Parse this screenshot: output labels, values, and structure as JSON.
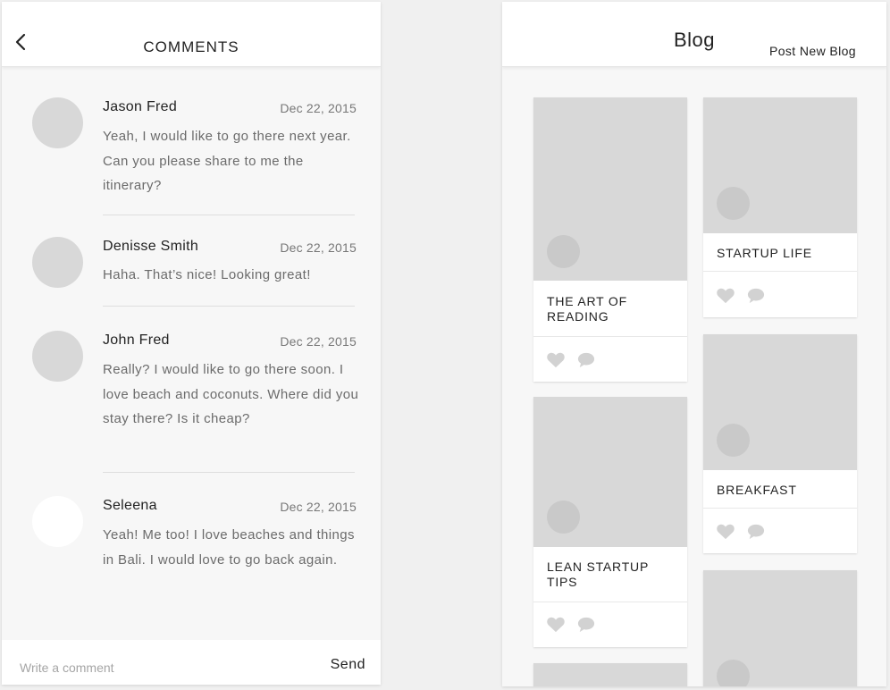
{
  "comments_screen": {
    "title": "COMMENTS",
    "back_icon": "chevron-left-icon",
    "comments": [
      {
        "name": "Jason Fred",
        "date": "Dec 22, 2015",
        "text": "Yeah, I would like to go there next year. Can you please share to me the itinerary?"
      },
      {
        "name": "Denisse Smith",
        "date": "Dec 22, 2015",
        "text": "Haha. That’s nice! Looking great!"
      },
      {
        "name": "John Fred",
        "date": "Dec 22, 2015",
        "text": "Really? I would like to go there soon. I love beach and coconuts. Where did you stay there? Is it cheap?"
      },
      {
        "name": "Seleena",
        "date": "Dec 22, 2015",
        "text": "Yeah! Me too! I love beaches and things in Bali. I would love to go back again."
      }
    ],
    "input_placeholder": "Write a comment",
    "send_label": "Send"
  },
  "blog_screen": {
    "title": "Blog",
    "post_new_label": "Post New Blog",
    "cards": [
      {
        "title": "THE ART OF READING"
      },
      {
        "title": "STARTUP LIFE"
      },
      {
        "title": "LEAN STARTUP TIPS"
      },
      {
        "title": "BREAKFAST"
      }
    ],
    "card_icons": [
      "heart-icon",
      "comment-icon"
    ]
  },
  "colors": {
    "placeholder_gray": "#d8d8d8",
    "background": "#f7f7f7",
    "text_dark": "#222222",
    "text_muted": "#6b6b6b"
  }
}
